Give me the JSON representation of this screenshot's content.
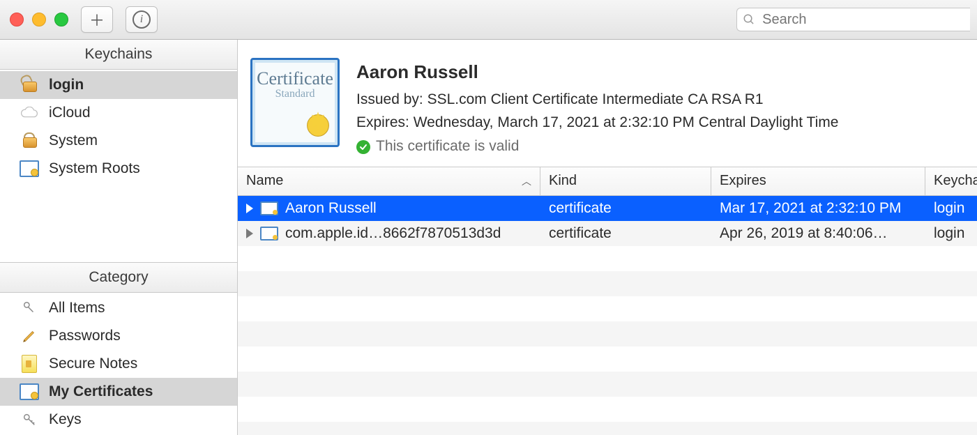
{
  "toolbar": {
    "search_placeholder": "Search"
  },
  "sidebar": {
    "keychains_header": "Keychains",
    "category_header": "Category",
    "keychains": [
      {
        "label": "login",
        "icon": "lock-unlocked",
        "selected": true
      },
      {
        "label": "iCloud",
        "icon": "cloud",
        "selected": false
      },
      {
        "label": "System",
        "icon": "lock",
        "selected": false
      },
      {
        "label": "System Roots",
        "icon": "cert",
        "selected": false
      }
    ],
    "categories": [
      {
        "label": "All Items",
        "icon": "keys",
        "selected": false
      },
      {
        "label": "Passwords",
        "icon": "pencil",
        "selected": false
      },
      {
        "label": "Secure Notes",
        "icon": "note",
        "selected": false
      },
      {
        "label": "My Certificates",
        "icon": "cert",
        "selected": true
      },
      {
        "label": "Keys",
        "icon": "key",
        "selected": false
      }
    ]
  },
  "detail": {
    "title": "Aaron  Russell",
    "issued_by_label": "Issued by:",
    "issued_by_value": "SSL.com Client Certificate Intermediate CA RSA R1",
    "expires_label": "Expires:",
    "expires_value": "Wednesday, March 17, 2021 at 2:32:10 PM Central Daylight Time",
    "status": "This certificate is valid",
    "cert_art_line1": "Certificate",
    "cert_art_line2": "Standard"
  },
  "table": {
    "columns": {
      "name": "Name",
      "kind": "Kind",
      "expires": "Expires",
      "keychain": "Keychain"
    },
    "rows": [
      {
        "name": "Aaron  Russell",
        "kind": "certificate",
        "expires": "Mar 17, 2021 at 2:32:10 PM",
        "keychain": "login",
        "selected": true
      },
      {
        "name": "com.apple.id…8662f7870513d3d",
        "kind": "certificate",
        "expires": "Apr 26, 2019 at 8:40:06…",
        "keychain": "login",
        "selected": false
      }
    ]
  }
}
